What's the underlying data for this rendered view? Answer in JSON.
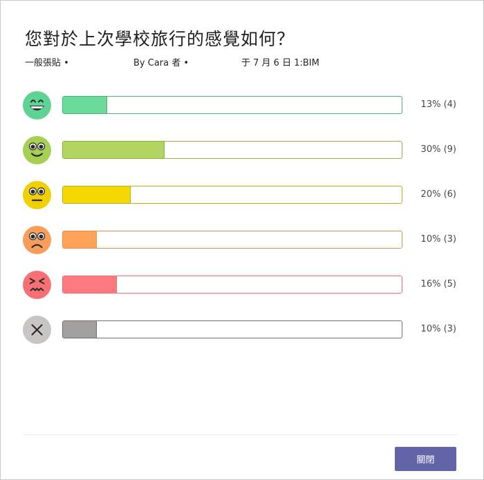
{
  "dialog": {
    "title": "您對於上次學校旅行的感覺如何？",
    "meta": {
      "posted_in": "一般張貼 •",
      "author": "By Cara 者 •",
      "date": "于 7 月 6 日 1:BIM"
    },
    "close_label": "關閉"
  },
  "poll": {
    "options": [
      {
        "icon": "grinning-face-icon",
        "percent": 13,
        "count": 4,
        "label": "13% (4)",
        "fill_color": "#6bdb9c",
        "border_color": "#3fb96e",
        "face_color": "#5fd393"
      },
      {
        "icon": "smiling-face-icon",
        "percent": 30,
        "count": 9,
        "label": "30% (9)",
        "fill_color": "#b2d561",
        "border_color": "#8db143",
        "face_color": "#a6cf53"
      },
      {
        "icon": "neutral-face-icon",
        "percent": 20,
        "count": 6,
        "label": "20% (6)",
        "fill_color": "#f3d900",
        "border_color": "#bfac1f",
        "face_color": "#f0d000"
      },
      {
        "icon": "frowning-face-icon",
        "percent": 10,
        "count": 3,
        "label": "10% (3)",
        "fill_color": "#ffa35b",
        "border_color": "#e0904f",
        "face_color": "#f99d5a"
      },
      {
        "icon": "tired-face-icon",
        "percent": 16,
        "count": 5,
        "label": "16% (5)",
        "fill_color": "#ff7a7e",
        "border_color": "#e86b70",
        "face_color": "#f87074"
      },
      {
        "icon": "cross-icon",
        "percent": 10,
        "count": 3,
        "label": "10% (3)",
        "fill_color": "#a3a19f",
        "border_color": "#6f6d6b",
        "face_color": "#c8c6c4"
      }
    ]
  }
}
